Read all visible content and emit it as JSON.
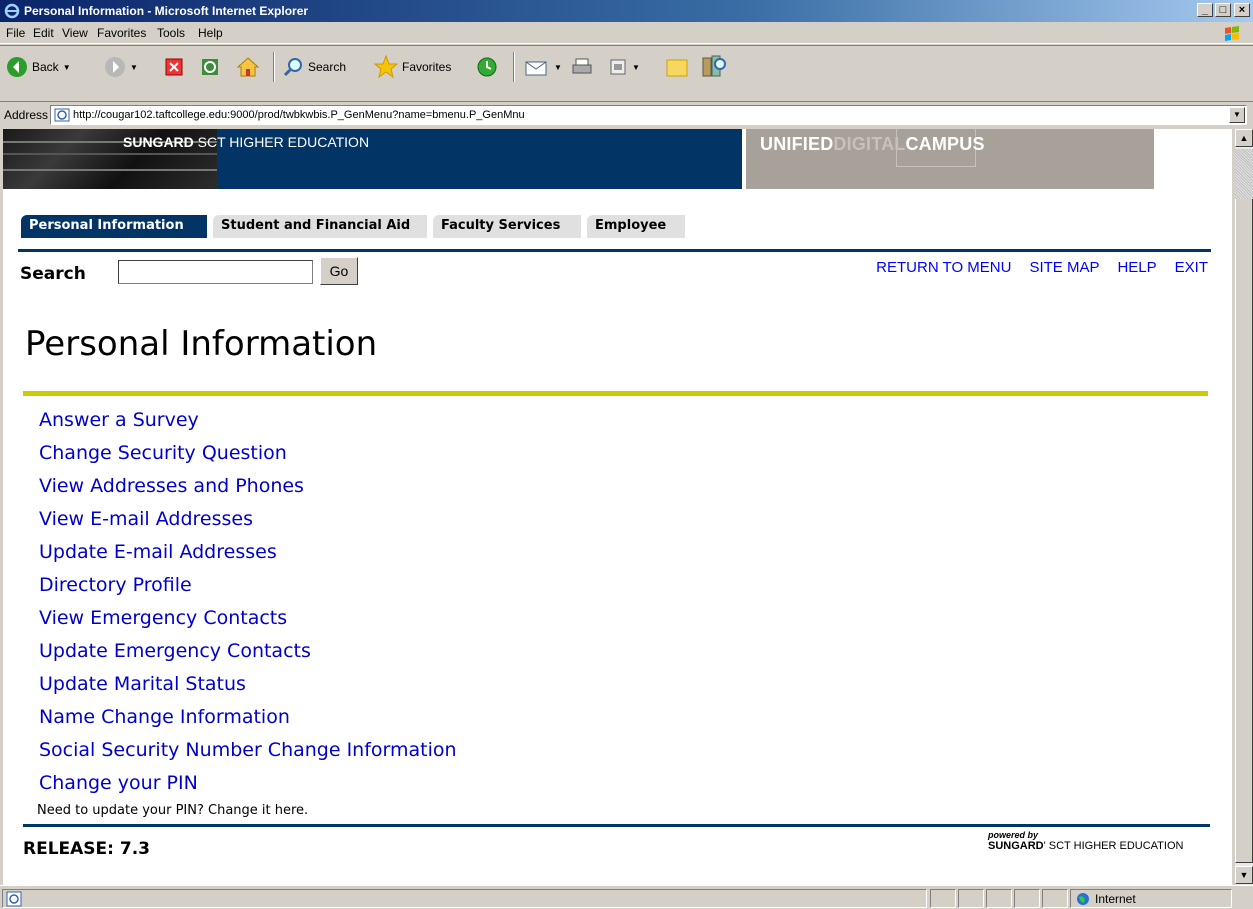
{
  "window": {
    "title": "Personal Information - Microsoft Internet Explorer",
    "controls": [
      "_",
      "□",
      "×"
    ]
  },
  "menubar": {
    "items": [
      "File",
      "Edit",
      "View",
      "Favorites",
      "Tools",
      "Help"
    ]
  },
  "toolbar": {
    "back_label": "Back",
    "search_label": "Search",
    "favorites_label": "Favorites"
  },
  "address": {
    "label": "Address",
    "url": "http://cougar102.taftcollege.edu:9000/prod/twbkwbis.P_GenMenu?name=bmenu.P_GenMnu"
  },
  "banner": {
    "brand_bold": "SUNGARD",
    "brand_rest": " SCT HIGHER EDUCATION",
    "udc_part1": "UNIFIED",
    "udc_part2": "DIGITAL",
    "udc_part3": "CAMPUS"
  },
  "tabs": [
    {
      "label": "Personal Information",
      "active": true
    },
    {
      "label": "Student and Financial Aid",
      "active": false
    },
    {
      "label": "Faculty Services",
      "active": false
    },
    {
      "label": "Employee",
      "active": false
    }
  ],
  "search": {
    "label": "Search",
    "value": "",
    "go_label": "Go"
  },
  "toplinks": [
    "RETURN TO MENU",
    "SITE MAP",
    "HELP",
    "EXIT"
  ],
  "page_title": "Personal Information",
  "menu_links": [
    "Answer a Survey",
    "Change Security Question",
    "View Addresses and Phones",
    "View E-mail Addresses",
    "Update E-mail Addresses",
    "Directory Profile",
    "View Emergency Contacts",
    "Update Emergency Contacts",
    "Update Marital Status",
    "Name Change Information",
    "Social Security Number Change Information",
    "Change your PIN"
  ],
  "pin_hint": "Need to update your PIN? Change it here.",
  "release": "RELEASE: 7.3",
  "powered": {
    "line1": "powered by",
    "line2_bold": "SUNGARD",
    "line2_rest": "' SCT HIGHER EDUCATION"
  },
  "status": {
    "zone": "Internet"
  },
  "colors": {
    "navy": "#023466",
    "link": "#0000cc",
    "rule_yellow": "#cccc00",
    "udc_bg": "#a7a19a"
  }
}
